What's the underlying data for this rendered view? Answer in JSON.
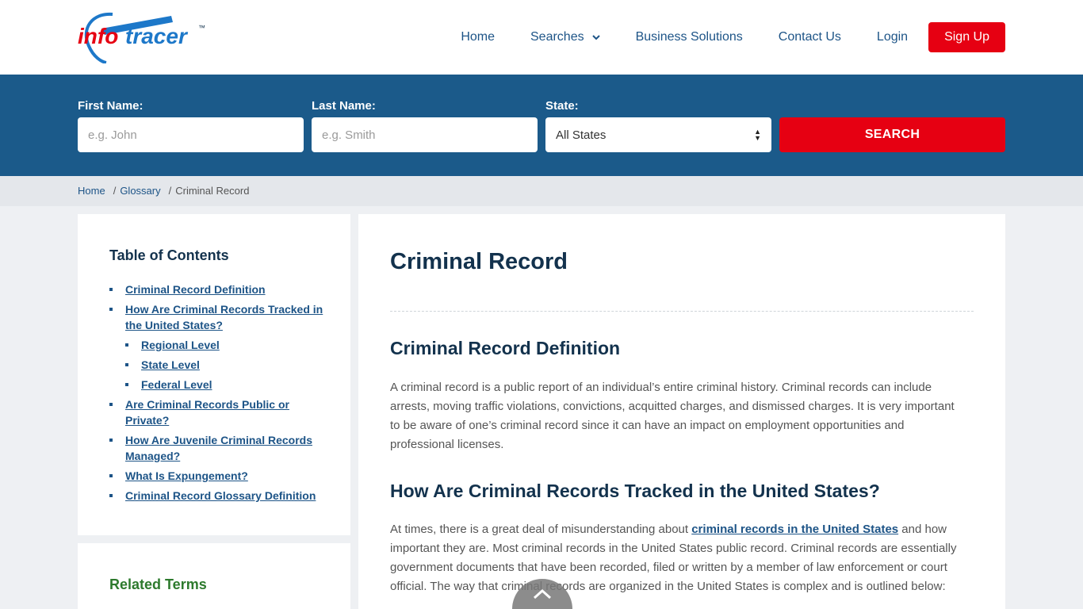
{
  "header": {
    "logo_left": "info",
    "logo_right": "tracer",
    "logo_tm": "™",
    "nav": {
      "home": "Home",
      "searches": "Searches",
      "business": "Business Solutions",
      "contact": "Contact Us",
      "login": "Login",
      "signup": "Sign Up"
    }
  },
  "search": {
    "first_label": "First Name:",
    "first_placeholder": "e.g. John",
    "last_label": "Last Name:",
    "last_placeholder": "e.g. Smith",
    "state_label": "State:",
    "state_value": "All States",
    "button": "SEARCH"
  },
  "breadcrumb": {
    "home": "Home",
    "glossary": "Glossary",
    "current": "Criminal Record",
    "sep": "/"
  },
  "toc": {
    "title": "Table of Contents",
    "items": [
      "Criminal Record Definition",
      "How Are Criminal Records Tracked in the United States?",
      "Regional Level",
      "State Level",
      "Federal Level",
      "Are Criminal Records Public or Private?",
      "How Are Juvenile Criminal Records Managed?",
      "What Is Expungement?",
      "Criminal Record Glossary Definition"
    ]
  },
  "related": {
    "title": "Related Terms"
  },
  "article": {
    "title": "Criminal Record",
    "h2_definition": "Criminal Record Definition",
    "p_definition": "A criminal record is a public report of an individual’s entire criminal history. Criminal records can include arrests, moving traffic violations, convictions, acquitted charges, and dismissed charges. It is very important to be aware of one’s criminal record since it can have an impact on employment opportunities and professional licenses.",
    "h2_tracked": "How Are Criminal Records Tracked in the United States?",
    "p_tracked_before": "At times, there is a great deal of misunderstanding about ",
    "p_tracked_link": "criminal records in the United States",
    "p_tracked_after": " and how important they are. Most criminal records in the United States public record. Criminal records are essentially government documents that have been recorded, filed or written by a member of law enforcement or court official. The way that criminal records are organized in the United States is complex and is outlined below:"
  },
  "colors": {
    "brand_blue": "#1b5a8a",
    "accent_red": "#e60012",
    "heading": "#13324d"
  }
}
